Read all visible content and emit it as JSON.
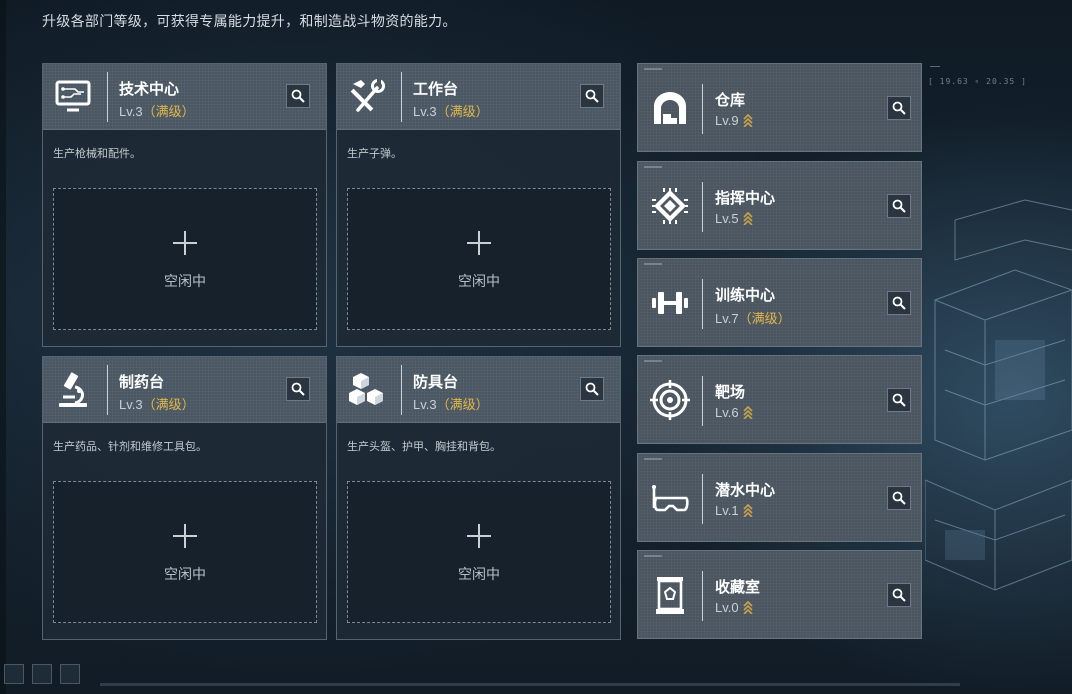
{
  "hint": "升级各部门等级，可获得专属能力提升，和制造战斗物资的能力。",
  "coords": "[ 19.63 ∘ 20.35 ]",
  "idle_label": "空闲中",
  "workbenches": [
    {
      "name": "技术中心",
      "level": "Lv.3",
      "status": "（满级）",
      "desc": "生产枪械和配件。",
      "icon": "monitor-circuit-icon"
    },
    {
      "name": "工作台",
      "level": "Lv.3",
      "status": "（满级）",
      "desc": "生产子弹。",
      "icon": "hammer-wrench-icon"
    },
    {
      "name": "制药台",
      "level": "Lv.3",
      "status": "（满级）",
      "desc": "生产药品、针剂和维修工具包。",
      "icon": "microscope-icon"
    },
    {
      "name": "防具台",
      "level": "Lv.3",
      "status": "（满级）",
      "desc": "生产头盔、护甲、胸挂和背包。",
      "icon": "cubes-icon"
    }
  ],
  "facilities": [
    {
      "name": "仓库",
      "level": "Lv.9",
      "status": "",
      "upgradable": true,
      "icon": "warehouse-icon"
    },
    {
      "name": "指挥中心",
      "level": "Lv.5",
      "status": "",
      "upgradable": true,
      "icon": "command-chip-icon"
    },
    {
      "name": "训练中心",
      "level": "Lv.7",
      "status": "（满级）",
      "upgradable": false,
      "icon": "dumbbell-icon"
    },
    {
      "name": "靶场",
      "level": "Lv.6",
      "status": "",
      "upgradable": true,
      "icon": "target-icon"
    },
    {
      "name": "潜水中心",
      "level": "Lv.1",
      "status": "",
      "upgradable": true,
      "icon": "diving-mask-icon"
    },
    {
      "name": "收藏室",
      "level": "Lv.0",
      "status": "",
      "upgradable": true,
      "icon": "display-case-icon"
    }
  ],
  "colors": {
    "max_level": "#e2b64a",
    "upgrade_arrow": "#c9a24a",
    "card_head": "#4a5762"
  }
}
